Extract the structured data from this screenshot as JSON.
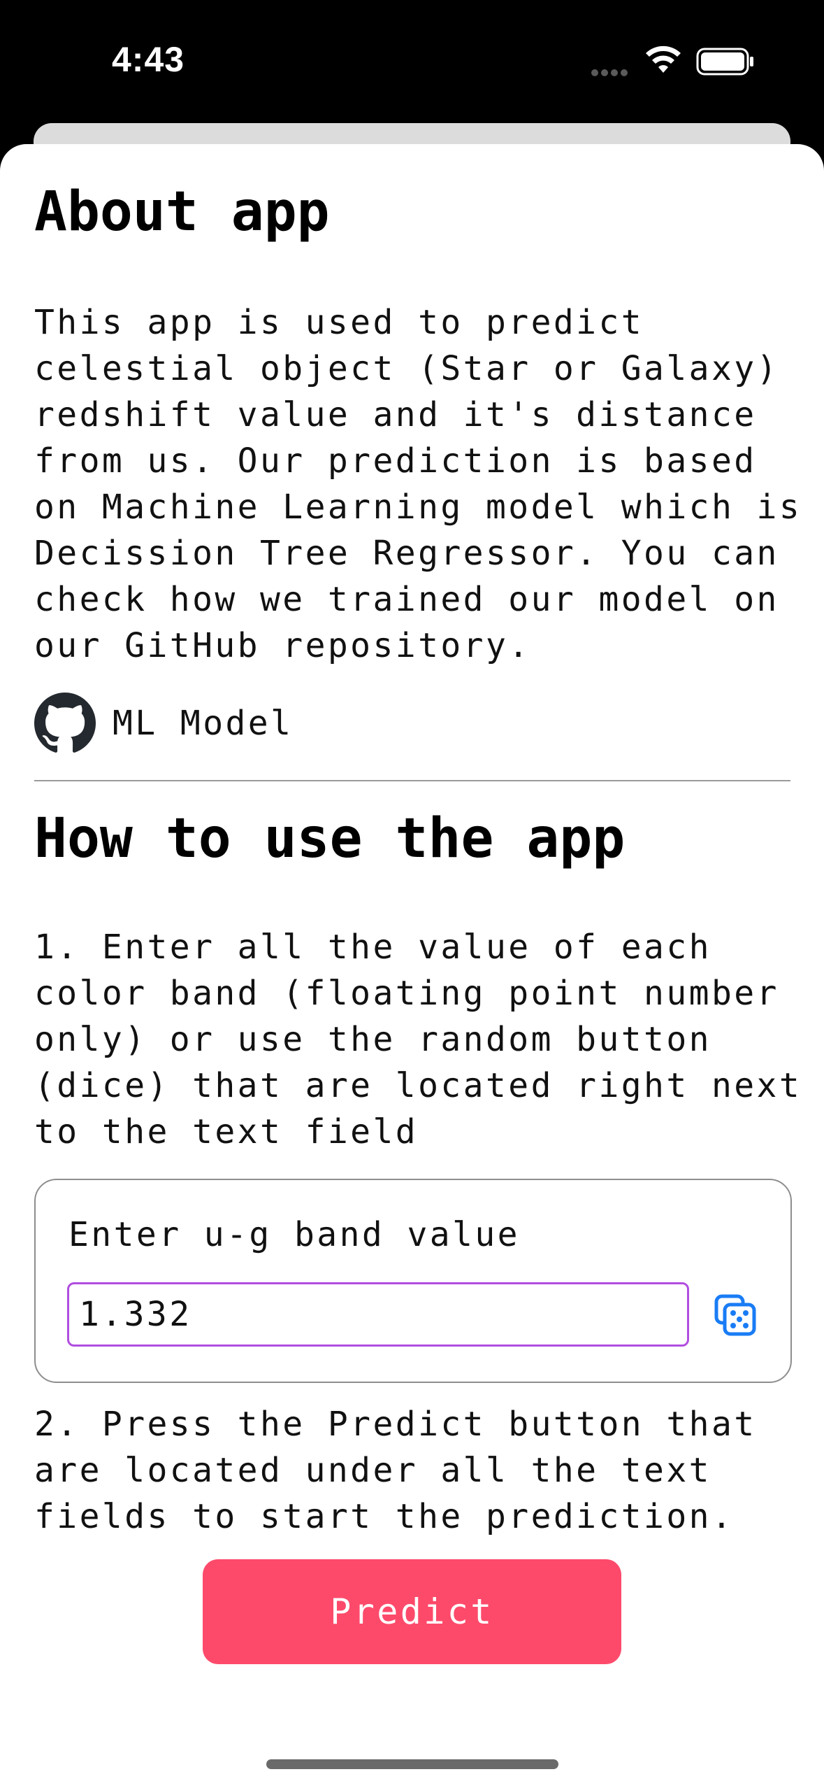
{
  "status_bar": {
    "time": "4:43",
    "icons": [
      "signal-dots-icon",
      "wifi-icon",
      "battery-icon"
    ]
  },
  "about": {
    "heading": "About app",
    "body": "This app is used to predict\ncelestial object (Star or Galaxy)\nredshift value and it's distance\nfrom us. Our prediction is based\non Machine Learning model which is\nDecission Tree Regressor. You can\ncheck how we trained our model on\nour GitHub repository.",
    "link": {
      "icon": "github-icon",
      "label": "ML Model"
    }
  },
  "how_to": {
    "heading": "How to use the app",
    "step1": "1. Enter all the value of each\ncolor band (floating point number\nonly) or use the random button\n(dice) that are located right next\nto the text field",
    "field": {
      "label": "Enter u-g band value",
      "value": "1.332",
      "random_icon": "dice-icon"
    },
    "step2": "2. Press the Predict button that\nare located under all the text\nfields to start the prediction.",
    "predict_label": "Predict"
  },
  "colors": {
    "predict_button": "#fd4a6b",
    "input_focus_border": "#b14ee0",
    "dice_icon": "#1a7cf5",
    "background": "#ffffff",
    "status_bar": "#000000"
  }
}
